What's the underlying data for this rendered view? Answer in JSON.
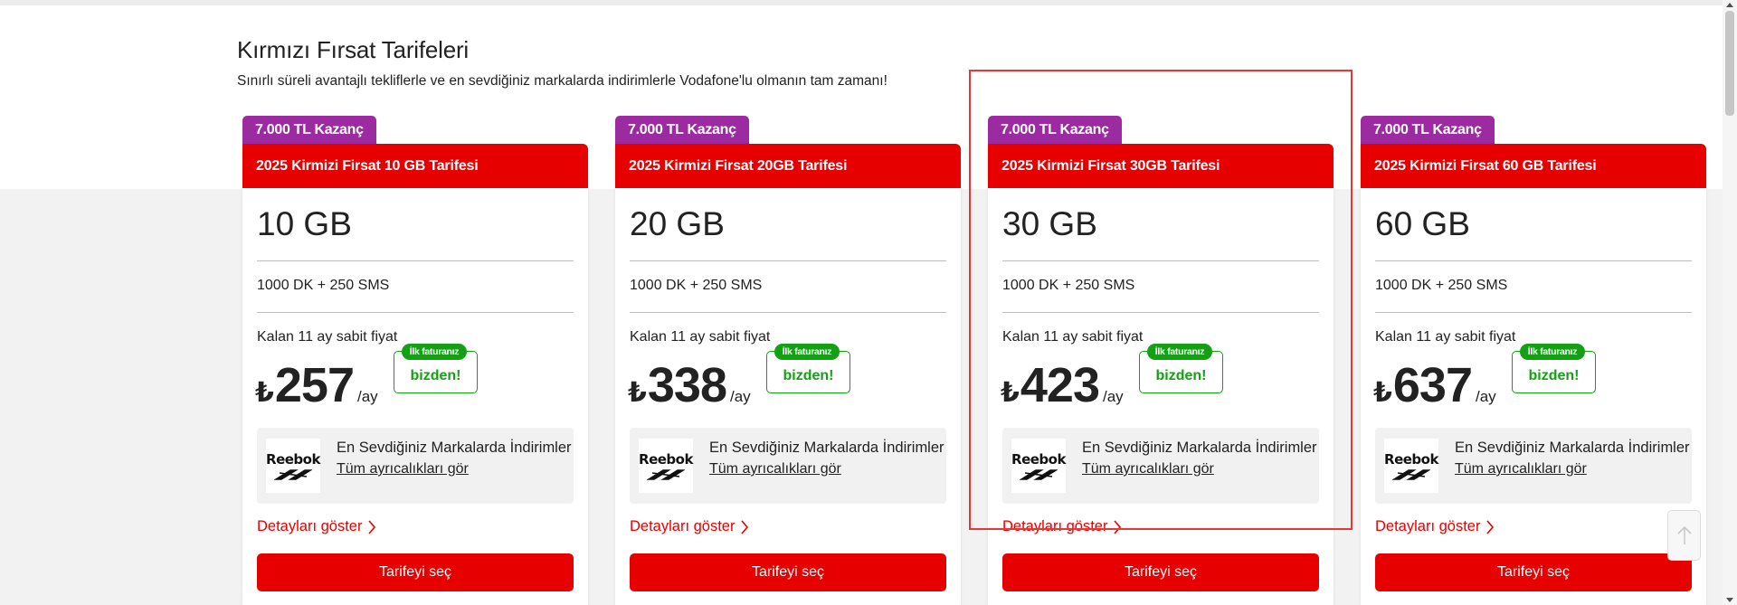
{
  "section": {
    "title": "Kırmızı Fırsat Tarifeleri",
    "subtitle": "Sınırlı süreli avantajlı tekliflerle ve en sevdiğiniz markalarda indirimlerle Vodafone'lu olmanın tam zamanı!"
  },
  "cards": [
    {
      "badge": "7.000 TL Kazanç",
      "name": "2025 Kirmizi Firsat 10 GB Tarifesi",
      "data": "10 GB",
      "minutes_sms": "1000 DK + 250 SMS",
      "price_note": "Kalan 11 ay sabit fiyat",
      "currency": "₺",
      "price": "257",
      "per": "/ay",
      "promo_top": "İlk faturanız",
      "promo_bottom": "bizden!",
      "brand_logo": "Reebok",
      "brand_title": "En Sevdiğiniz Markalarda İndirimler",
      "brand_link": "Tüm ayrıcalıkları gör",
      "details": "Detayları göster",
      "select": "Tarifeyi seç"
    },
    {
      "badge": "7.000 TL Kazanç",
      "name": "2025 Kirmizi Firsat 20GB Tarifesi",
      "data": "20 GB",
      "minutes_sms": "1000 DK + 250 SMS",
      "price_note": "Kalan 11 ay sabit fiyat",
      "currency": "₺",
      "price": "338",
      "per": "/ay",
      "promo_top": "İlk faturanız",
      "promo_bottom": "bizden!",
      "brand_logo": "Reebok",
      "brand_title": "En Sevdiğiniz Markalarda İndirimler",
      "brand_link": "Tüm ayrıcalıkları gör",
      "details": "Detayları göster",
      "select": "Tarifeyi seç"
    },
    {
      "badge": "7.000 TL Kazanç",
      "name": "2025 Kirmizi Firsat 30GB Tarifesi",
      "data": "30 GB",
      "minutes_sms": "1000 DK + 250 SMS",
      "price_note": "Kalan 11 ay sabit fiyat",
      "currency": "₺",
      "price": "423",
      "per": "/ay",
      "promo_top": "İlk faturanız",
      "promo_bottom": "bizden!",
      "brand_logo": "Reebok",
      "brand_title": "En Sevdiğiniz Markalarda İndirimler",
      "brand_link": "Tüm ayrıcalıkları gör",
      "details": "Detayları göster",
      "select": "Tarifeyi seç"
    },
    {
      "badge": "7.000 TL Kazanç",
      "name": "2025 Kirmizi Firsat 60 GB Tarifesi",
      "data": "60 GB",
      "minutes_sms": "1000 DK + 250 SMS",
      "price_note": "Kalan 11 ay sabit fiyat",
      "currency": "₺",
      "price": "637",
      "per": "/ay",
      "promo_top": "İlk faturanız",
      "promo_bottom": "bizden!",
      "brand_logo": "Reebok",
      "brand_title": "En Sevdiğiniz Markalarda İndirimler",
      "brand_link": "Tüm ayrıcalıkları gör",
      "details": "Detayları göster",
      "select": "Tarifeyi seç"
    }
  ],
  "colors": {
    "brand_red": "#e60000",
    "badge_purple": "#9c2aa0",
    "promo_green": "#14a014",
    "highlight": "#e53935"
  },
  "icons": {
    "details": "chevron-right-icon",
    "scroll_top": "arrow-up-icon",
    "brand": "reebok-logo-icon"
  }
}
